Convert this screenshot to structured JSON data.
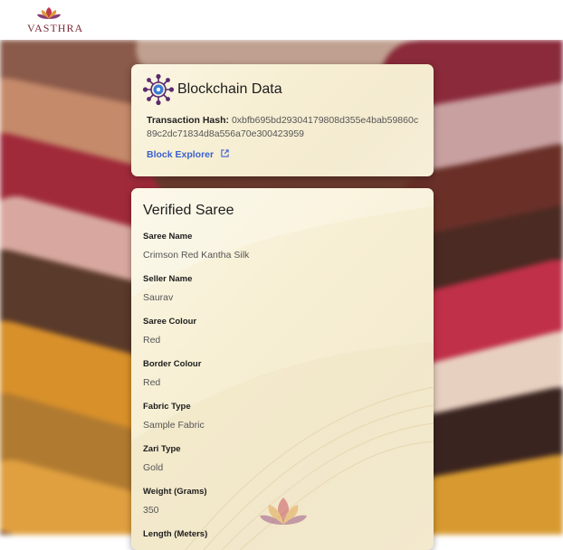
{
  "header": {
    "logo_text": "VASTHRA"
  },
  "blockchain": {
    "title": "Blockchain Data",
    "hash_label": "Transaction Hash:",
    "hash_value": "0xbfb695bd29304179808d355e4bab59860c89c2dc71834d8a556a70e300423959",
    "explorer_label": "Block Explorer"
  },
  "saree": {
    "title": "Verified Saree",
    "fields": [
      {
        "label": "Saree Name",
        "value": "Crimson Red Kantha Silk"
      },
      {
        "label": "Seller Name",
        "value": "Saurav"
      },
      {
        "label": "Saree Colour",
        "value": "Red"
      },
      {
        "label": "Border Colour",
        "value": "Red"
      },
      {
        "label": "Fabric Type",
        "value": "Sample Fabric"
      },
      {
        "label": "Zari Type",
        "value": "Gold"
      },
      {
        "label": "Weight (Grams)",
        "value": "350"
      },
      {
        "label": "Length (Meters)",
        "value": ""
      }
    ],
    "watermark_text": "VASTHRA"
  },
  "colors": {
    "link": "#3a5fd0",
    "brand": "#7a2a35",
    "icon": "#5a2a6e"
  }
}
